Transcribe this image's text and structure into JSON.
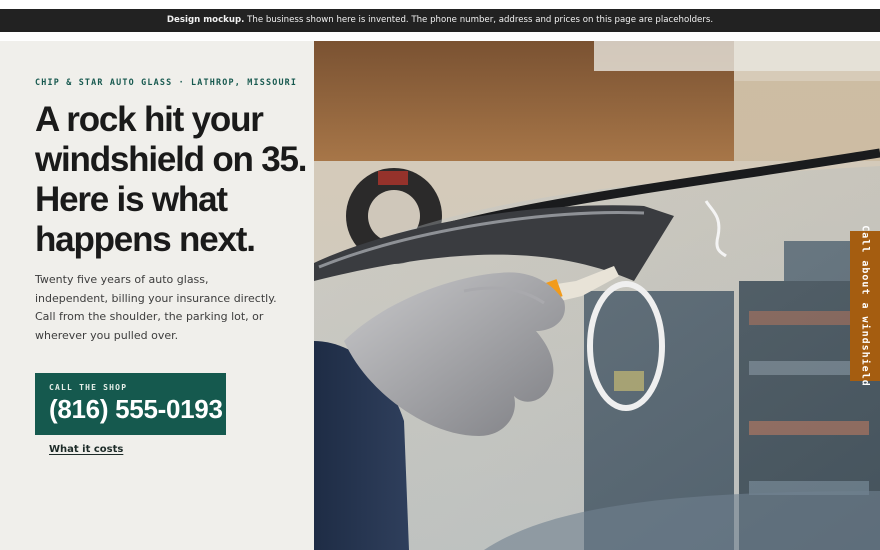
{
  "banner": {
    "strong": "Design mockup.",
    "text": " The business shown here is invented. The phone number, address and prices on this page are placeholders."
  },
  "hero": {
    "eyebrow": "CHIP & STAR AUTO GLASS · LATHROP, MISSOURI",
    "headline": "A rock hit your windshield on 35. Here is what happens next.",
    "body": "Twenty five years of auto glass, independent, billing your insurance directly. Call from the shoulder, the parking lot, or wherever you pulled over.",
    "call_label": "CALL THE SHOP",
    "call_number": "(816) 555-0193",
    "costs_link": "What it costs"
  },
  "side_tab": {
    "label": "Call about a windshield"
  },
  "photo": {
    "description_icon": "windshield-repair-photo"
  },
  "colors": {
    "accent_green": "#15594e",
    "tab_orange": "#a55d10",
    "banner_bg": "#222222",
    "panel_bg": "#f0efeb"
  }
}
